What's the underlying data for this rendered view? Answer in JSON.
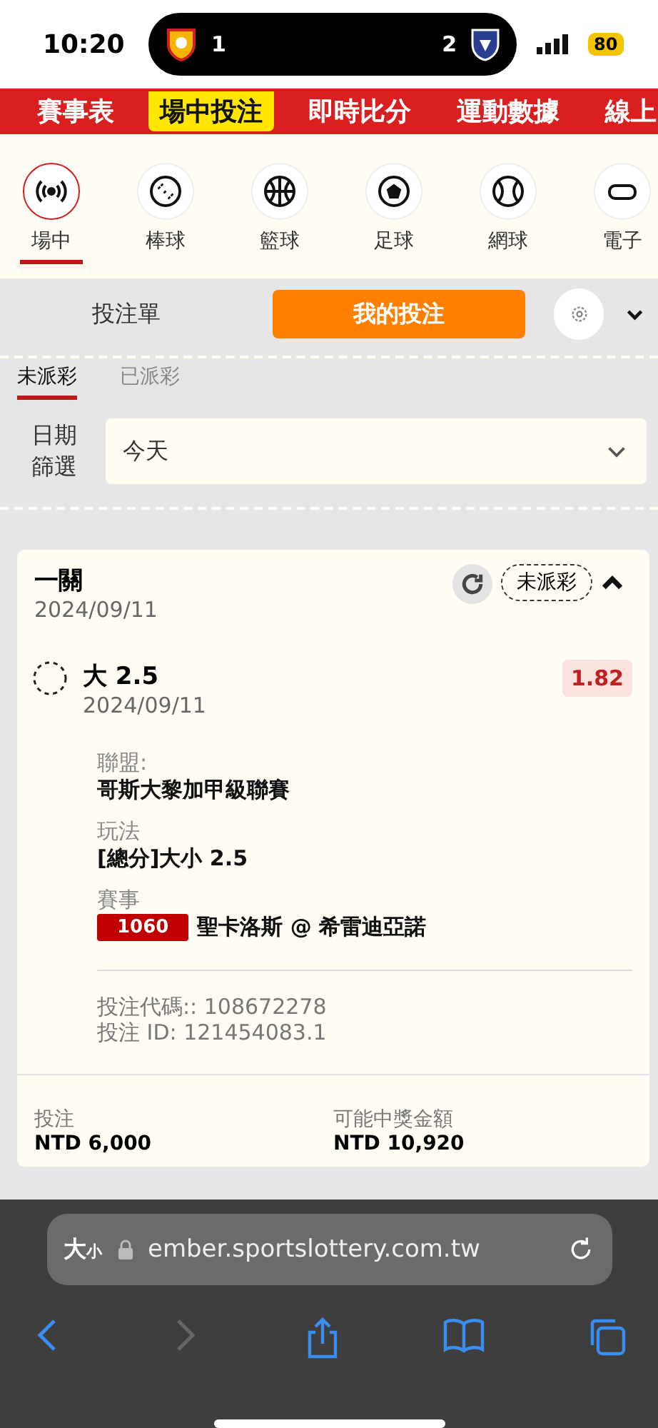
{
  "status_bar": {
    "time": "10:20",
    "home_score": "1",
    "away_score": "2",
    "battery": "80"
  },
  "nav": [
    {
      "label": "賽事表",
      "selected": false
    },
    {
      "label": "場中投注",
      "selected": true
    },
    {
      "label": "即時比分",
      "selected": false
    },
    {
      "label": "運動數據",
      "selected": false
    },
    {
      "label": "線上",
      "selected": false
    }
  ],
  "sports": [
    {
      "label": "場中",
      "kind": "live",
      "selected": true
    },
    {
      "label": "棒球",
      "kind": "baseball",
      "selected": false
    },
    {
      "label": "籃球",
      "kind": "basketball",
      "selected": false
    },
    {
      "label": "足球",
      "kind": "soccer",
      "selected": false
    },
    {
      "label": "網球",
      "kind": "tennis",
      "selected": false
    },
    {
      "label": "電子",
      "kind": "esports",
      "selected": false
    }
  ],
  "bet_tabs": [
    {
      "label": "投注單",
      "selected": false
    },
    {
      "label": "我的投注",
      "selected": true
    }
  ],
  "status_tabs": [
    {
      "label": "未派彩",
      "selected": true
    },
    {
      "label": "已派彩",
      "selected": false
    }
  ],
  "date_filter": {
    "label": "日期篩選",
    "value": "今天"
  },
  "bet": {
    "title": "一關",
    "date": "2024/09/11",
    "status": "未派彩",
    "expanded": true,
    "selection": "大 2.5",
    "selection_date": "2024/09/11",
    "odds": "1.82",
    "fields": [
      {
        "label": "聯盟:",
        "value": "哥斯大黎加甲級聯賽"
      },
      {
        "label": "玩法",
        "value": "[總分]大小 2.5"
      },
      {
        "label": "賽事",
        "badge": "1060",
        "value": "聖卡洛斯 @ 希雷迪亞諾"
      }
    ],
    "codes": [
      "投注代碼:: 108672278",
      "投注 ID: 121454083.1"
    ],
    "stake_label": "投注",
    "stake": "NTD 6,000",
    "payout_label": "可能中獎金額",
    "payout": "NTD 10,920"
  },
  "browser": {
    "reader_big": "大",
    "reader_small": "小",
    "url": "ember.sportslottery.com.tw"
  }
}
